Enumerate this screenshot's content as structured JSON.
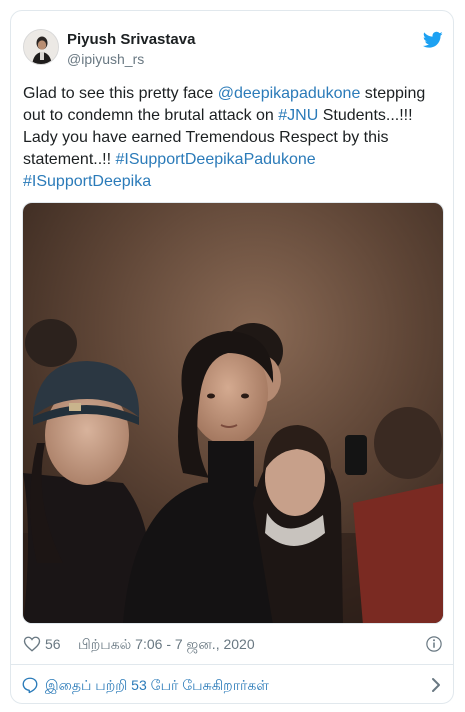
{
  "author": {
    "name": "Piyush Srivastava",
    "handle": "@ipiyush_rs"
  },
  "tweet": {
    "t1": "Glad to see this pretty face ",
    "mention": "@deepikapadukone",
    "t2": " stepping out to condemn the brutal attack on ",
    "hashtag_jnu": "#JNU",
    "t3": " Students...!!! Lady you have earned Tremendous Respect by this statement..!! ",
    "hashtag_1": "#ISupportDeepikaPadukone",
    "hashtag_2": "#ISupportDeepika"
  },
  "stats": {
    "likes": "56",
    "timestamp": "பிற்பகல் 7:06 - 7 ஜன., 2020"
  },
  "footer": {
    "text": "இதைப் பற்றி 53 பேர் பேசுகிறார்கள்"
  },
  "colors": {
    "link": "#2b7bb9",
    "muted": "#697882",
    "twitter_blue": "#1da1f2"
  },
  "icons": {
    "logo": "twitter-bird-icon",
    "like": "heart-icon",
    "info": "info-icon",
    "reply": "speech-bubble-icon",
    "more": "chevron-right-icon"
  }
}
